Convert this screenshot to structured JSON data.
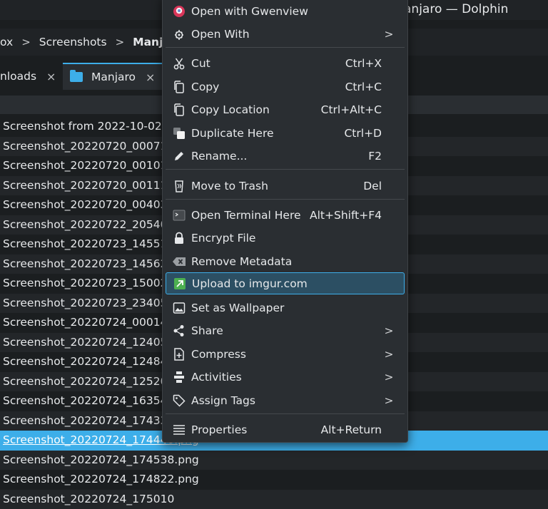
{
  "window": {
    "title": "anjaro — Dolphin"
  },
  "breadcrumb": {
    "items": [
      "ox",
      "Screenshots",
      "Manjar"
    ],
    "separator": ">"
  },
  "tabs": [
    {
      "label": "nloads",
      "close": "×"
    },
    {
      "label": "Manjaro",
      "close": "×"
    }
  ],
  "files": [
    "Screenshot from 2022-10-02 2",
    "Screenshot_20220720_00071",
    "Screenshot_20220720_001010",
    "Screenshot_20220720_00111",
    "Screenshot_20220720_004034",
    "Screenshot_20220722_205400",
    "Screenshot_20220723_145514",
    "Screenshot_20220723_145628",
    "Screenshot_20220723_150029",
    "Screenshot_20220723_234059",
    "Screenshot_20220724_000142",
    "Screenshot_20220724_124054",
    "Screenshot_20220724_124840",
    "Screenshot_20220724_125205",
    "Screenshot_20220724_163542",
    "Screenshot_20220724_17433",
    "Screenshot_20220724_174440.png",
    "Screenshot_20220724_174538.png",
    "Screenshot_20220724_174822.png",
    "Screenshot_20220724_175010"
  ],
  "selected_file_index": 16,
  "menu": {
    "items": [
      {
        "label": "Open with Gwenview",
        "shortcut": "",
        "submenu": false,
        "icon": "gwenview-icon"
      },
      {
        "label": "Open With",
        "shortcut": "",
        "submenu": true,
        "icon": "gear-icon"
      },
      {
        "label": "Cut",
        "shortcut": "Ctrl+X",
        "submenu": false,
        "icon": "scissors-icon"
      },
      {
        "label": "Copy",
        "shortcut": "Ctrl+C",
        "submenu": false,
        "icon": "copy-icon"
      },
      {
        "label": "Copy Location",
        "shortcut": "Ctrl+Alt+C",
        "submenu": false,
        "icon": "copy-location-icon"
      },
      {
        "label": "Duplicate Here",
        "shortcut": "Ctrl+D",
        "submenu": false,
        "icon": "duplicate-icon"
      },
      {
        "label": "Rename...",
        "shortcut": "F2",
        "submenu": false,
        "icon": "pencil-icon"
      },
      {
        "label": "Move to Trash",
        "shortcut": "Del",
        "submenu": false,
        "icon": "trash-icon"
      },
      {
        "label": "Open Terminal Here",
        "shortcut": "Alt+Shift+F4",
        "submenu": false,
        "icon": "terminal-icon"
      },
      {
        "label": "Encrypt File",
        "shortcut": "",
        "submenu": false,
        "icon": "lock-icon"
      },
      {
        "label": "Remove Metadata",
        "shortcut": "",
        "submenu": false,
        "icon": "remove-metadata-icon"
      },
      {
        "label": "Upload to imgur.com",
        "shortcut": "",
        "submenu": false,
        "icon": "imgur-upload-icon"
      },
      {
        "label": "Set as Wallpaper",
        "shortcut": "",
        "submenu": false,
        "icon": "wallpaper-icon"
      },
      {
        "label": "Share",
        "shortcut": "",
        "submenu": true,
        "icon": "share-icon"
      },
      {
        "label": "Compress",
        "shortcut": "",
        "submenu": true,
        "icon": "compress-icon"
      },
      {
        "label": "Activities",
        "shortcut": "",
        "submenu": true,
        "icon": "activities-icon"
      },
      {
        "label": "Assign Tags",
        "shortcut": "",
        "submenu": true,
        "icon": "tag-icon"
      },
      {
        "label": "Properties",
        "shortcut": "Alt+Return",
        "submenu": false,
        "icon": "properties-icon"
      }
    ],
    "highlighted_index": 11,
    "submenu_arrow": ">"
  },
  "colors": {
    "selection": "#3daee9",
    "menu_bg": "#2a2e32",
    "highlight_bg": "#2c4f63"
  }
}
